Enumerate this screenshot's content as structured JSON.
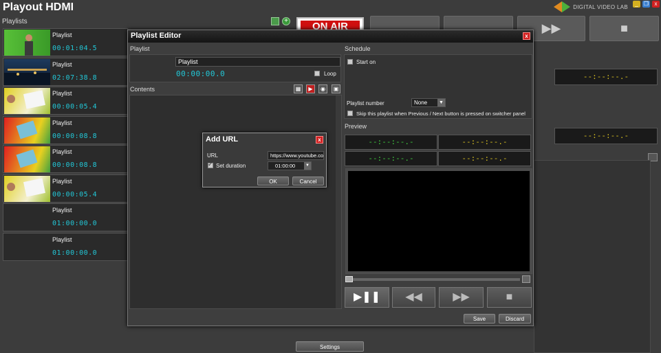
{
  "app": {
    "title": "Playout HDMI",
    "brand": "DIGITAL VIDEO LAB"
  },
  "playlists_label": "Playlists",
  "playlists": [
    {
      "name": "Playlist",
      "duration": "00:01:04.5"
    },
    {
      "name": "Playlist",
      "duration": "02:07:38.8"
    },
    {
      "name": "Playlist",
      "duration": "00:00:05.4"
    },
    {
      "name": "Playlist",
      "duration": "00:00:08.8"
    },
    {
      "name": "Playlist",
      "duration": "00:00:08.8"
    },
    {
      "name": "Playlist",
      "duration": "00:00:05.4"
    },
    {
      "name": "Playlist",
      "duration": "01:00:00.0"
    },
    {
      "name": "Playlist",
      "duration": "01:00:00.0"
    }
  ],
  "background": {
    "onair": "ON AIR",
    "timecode": "--:--:--.-",
    "settings_label": "Settings"
  },
  "editor": {
    "title": "Playlist Editor",
    "playlist_section": "Playlist",
    "playlist_name": "Playlist",
    "playlist_duration": "00:00:00.0",
    "loop_label": "Loop",
    "contents_label": "Contents",
    "schedule": {
      "label": "Schedule",
      "start_on_label": "Start on",
      "playlist_number_label": "Playlist number",
      "playlist_number_value": "None",
      "skip_label": "Skip this playlist when Previous / Next button is pressed on switcher panel"
    },
    "preview": {
      "label": "Preview",
      "timecodes": [
        "--:--:--.-",
        "--:--:--.-",
        "--:--:--.-",
        "--:--:--.-"
      ]
    },
    "save_label": "Save",
    "discard_label": "Discard"
  },
  "dialog": {
    "title": "Add URL",
    "url_label": "URL",
    "url_value": "https://www.youtube.co",
    "set_duration_label": "Set duration",
    "duration_value": "01:00:00",
    "ok_label": "OK",
    "cancel_label": "Cancel"
  },
  "colors": {
    "timecode_cyan": "#22c8d8",
    "timecode_green": "#3ecc3e",
    "timecode_yellow": "#d8c020",
    "onair_red": "#d01010"
  }
}
